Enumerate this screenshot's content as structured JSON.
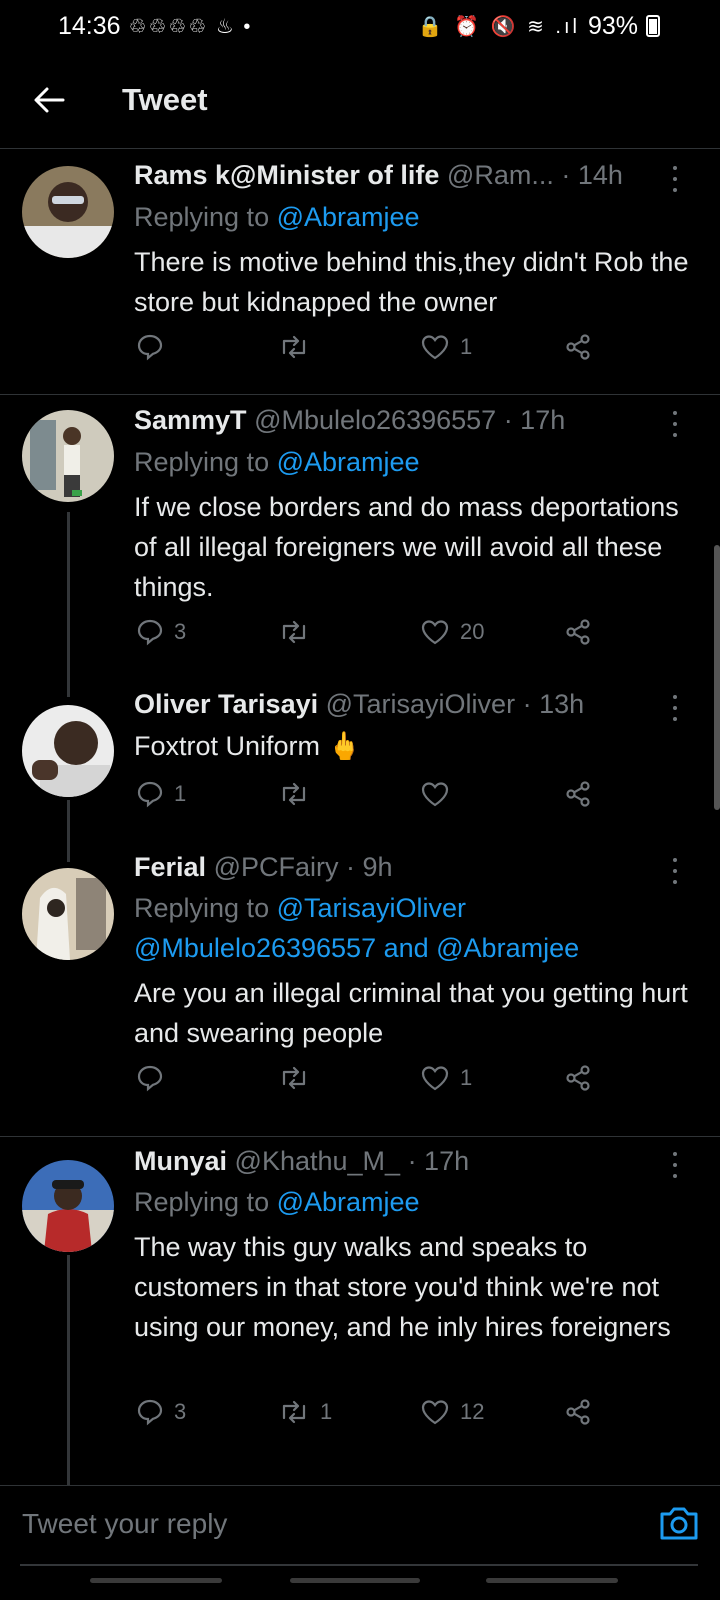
{
  "status": {
    "time": "14:36",
    "notif_icons": "♲♲♲♲ ♨ •",
    "sys_icons": "🔒 ⏰ 🔇 ≋ .ıl",
    "battery": "93%"
  },
  "header": {
    "title": "Tweet",
    "back_icon": "arrow-left-icon"
  },
  "tweets": [
    {
      "name": "Rams k@Minister of life",
      "handle": "@Ram...",
      "time": "· 14h",
      "replying_label": "Replying to",
      "replying_to": "@Abramjee",
      "text": "There is motive behind this,they didn't Rob the store but kidnapped the owner",
      "replies": "",
      "retweets": "",
      "likes": "1",
      "avatar_colors": [
        "#7a6a55",
        "#d8d8d8"
      ]
    },
    {
      "name": "SammyT",
      "handle": "@Mbulelo26396557",
      "time": "· 17h",
      "replying_label": "Replying to",
      "replying_to": "@Abramjee",
      "text": "If we close borders and do mass deportations of all illegal foreigners we will avoid all these things.",
      "replies": "3",
      "retweets": "",
      "likes": "20",
      "avatar_colors": [
        "#c7c3b6",
        "#6a5a48"
      ]
    },
    {
      "name": "Oliver Tarisayi",
      "handle": "@TarisayiOliver",
      "time": "· 13h",
      "text": "Foxtrot Uniform 🖕",
      "replies": "1",
      "retweets": "",
      "likes": "",
      "avatar_colors": [
        "#e6e6e6",
        "#3a2a20"
      ]
    },
    {
      "name": "Ferial",
      "handle": "@PCFairy",
      "time": "· 9h",
      "replying_label": "Replying to",
      "replying_to": "@TarisayiOliver",
      "replying_to_line2": "@Mbulelo26396557 and @Abramjee",
      "text": "Are you an illegal criminal that you getting hurt and swearing people",
      "replies": "",
      "retweets": "",
      "likes": "1",
      "avatar_colors": [
        "#d9cfc2",
        "#5a4a40"
      ]
    },
    {
      "name": "Munyai",
      "handle": "@Khathu_M_",
      "time": "· 17h",
      "replying_label": "Replying to",
      "replying_to": "@Abramjee",
      "text": "The way this guy walks and speaks to customers in that store you'd think we're not using our money, and he inly hires foreigners",
      "replies": "3",
      "retweets": "1",
      "likes": "12",
      "avatar_colors": [
        "#2a5aa8",
        "#b02a2a"
      ]
    }
  ],
  "composer": {
    "placeholder": "Tweet your reply",
    "camera_icon": "camera-icon"
  },
  "colors": {
    "bg": "#000000",
    "text": "#e7e9ea",
    "muted": "#71767b",
    "accent": "#1d9bf0",
    "divider": "#2f3336"
  }
}
